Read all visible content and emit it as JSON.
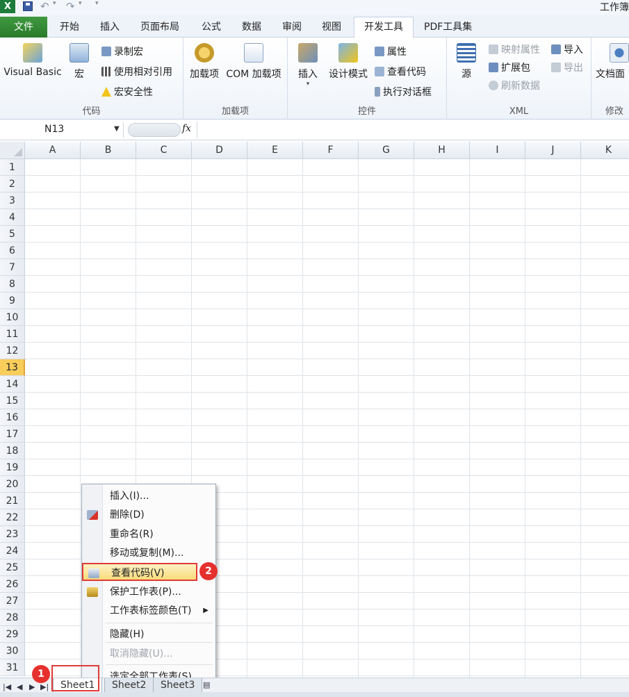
{
  "window": {
    "title": "工作簿"
  },
  "qat": {
    "app_icon": "X"
  },
  "tabs": {
    "file": "文件",
    "items": [
      "开始",
      "插入",
      "页面布局",
      "公式",
      "数据",
      "审阅",
      "视图"
    ],
    "active": "开发工具",
    "after": "PDF工具集"
  },
  "ribbon": {
    "code_group": {
      "label": "代码",
      "visual_basic": "Visual Basic",
      "macro": "宏",
      "record_macro": "录制宏",
      "relative_ref": "使用相对引用",
      "macro_security": "宏安全性"
    },
    "addins_group": {
      "label": "加载项",
      "addins": "加载项",
      "com_addins": "COM 加载项"
    },
    "controls_group": {
      "label": "控件",
      "insert": "插入",
      "design_mode": "设计模式",
      "properties": "属性",
      "view_code": "查看代码",
      "run_dialog": "执行对话框"
    },
    "xml_group": {
      "label": "XML",
      "source": "源",
      "map_properties": "映射属性",
      "expansion_packs": "扩展包",
      "refresh_data": "刷新数据",
      "import": "导入",
      "export": "导出"
    },
    "modify_group": {
      "label": "修改",
      "doc_panel": "文档面"
    }
  },
  "formula_bar": {
    "name_box": "N13",
    "fx": "fx",
    "value": ""
  },
  "grid": {
    "columns": [
      "A",
      "B",
      "C",
      "D",
      "E",
      "F",
      "G",
      "H",
      "I",
      "J",
      "K"
    ],
    "rows": [
      "1",
      "2",
      "3",
      "4",
      "5",
      "6",
      "7",
      "8",
      "9",
      "10",
      "11",
      "12",
      "13",
      "14",
      "15",
      "16",
      "17",
      "18",
      "19",
      "20",
      "21",
      "22",
      "23",
      "24",
      "25",
      "26",
      "27",
      "28",
      "29",
      "30",
      "31"
    ],
    "active_row": "13"
  },
  "sheets": {
    "tabs": [
      "Sheet1",
      "Sheet2",
      "Sheet3"
    ],
    "active": "Sheet1"
  },
  "context_menu": {
    "items": [
      {
        "label": "插入(I)...",
        "icon": "",
        "state": "normal"
      },
      {
        "label": "删除(D)",
        "icon": "delete-sheet-icon",
        "state": "normal"
      },
      {
        "label": "重命名(R)",
        "icon": "",
        "state": "normal"
      },
      {
        "label": "移动或复制(M)...",
        "icon": "",
        "state": "normal"
      },
      {
        "label": "查看代码(V)",
        "icon": "view-code-icon",
        "state": "highlight"
      },
      {
        "label": "保护工作表(P)...",
        "icon": "protect-sheet-icon",
        "state": "normal"
      },
      {
        "label": "工作表标签颜色(T)",
        "icon": "",
        "state": "submenu"
      },
      {
        "label": "隐藏(H)",
        "icon": "",
        "state": "normal"
      },
      {
        "label": "取消隐藏(U)...",
        "icon": "",
        "state": "disabled"
      },
      {
        "label": "选定全部工作表(S)",
        "icon": "",
        "state": "normal"
      }
    ]
  },
  "annotations": {
    "step1": "1",
    "step2": "2"
  },
  "colors": {
    "accent_green": "#2a7a2c",
    "highlight_red": "#e5302e",
    "active_row": "#f8cd5a"
  }
}
